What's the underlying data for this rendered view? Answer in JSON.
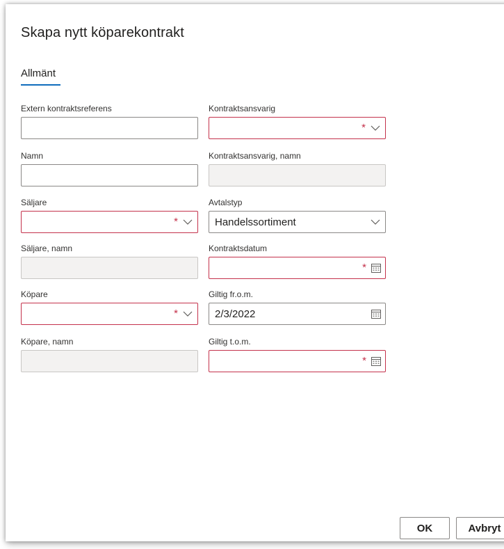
{
  "dialog": {
    "title": "Skapa nytt köparekontrakt",
    "tab_label": "Allmänt"
  },
  "fields": {
    "extern_ref": {
      "label": "Extern kontraktsreferens",
      "value": ""
    },
    "kontraktsansvarig": {
      "label": "Kontraktsansvarig",
      "value": "",
      "required_mark": "*"
    },
    "namn": {
      "label": "Namn",
      "value": ""
    },
    "kontraktsansvarig_namn": {
      "label": "Kontraktsansvarig, namn",
      "value": ""
    },
    "saljare": {
      "label": "Säljare",
      "value": "",
      "required_mark": "*"
    },
    "avtalstyp": {
      "label": "Avtalstyp",
      "value": "Handelssortiment"
    },
    "saljare_namn": {
      "label": "Säljare, namn",
      "value": ""
    },
    "kontraktsdatum": {
      "label": "Kontraktsdatum",
      "value": "",
      "required_mark": "*"
    },
    "kopare": {
      "label": "Köpare",
      "value": "",
      "required_mark": "*"
    },
    "giltig_from": {
      "label": "Giltig fr.o.m.",
      "value": "2/3/2022"
    },
    "kopare_namn": {
      "label": "Köpare, namn",
      "value": ""
    },
    "giltig_tom": {
      "label": "Giltig t.o.m.",
      "value": "",
      "required_mark": "*"
    }
  },
  "buttons": {
    "ok_label": "OK",
    "cancel_label": "Avbryt"
  },
  "colors": {
    "accent": "#0f6cbd",
    "required_border": "#c4314b",
    "readonly_fill": "#f3f2f1"
  },
  "icons": [
    "chevron-down-icon",
    "calendar-icon"
  ]
}
